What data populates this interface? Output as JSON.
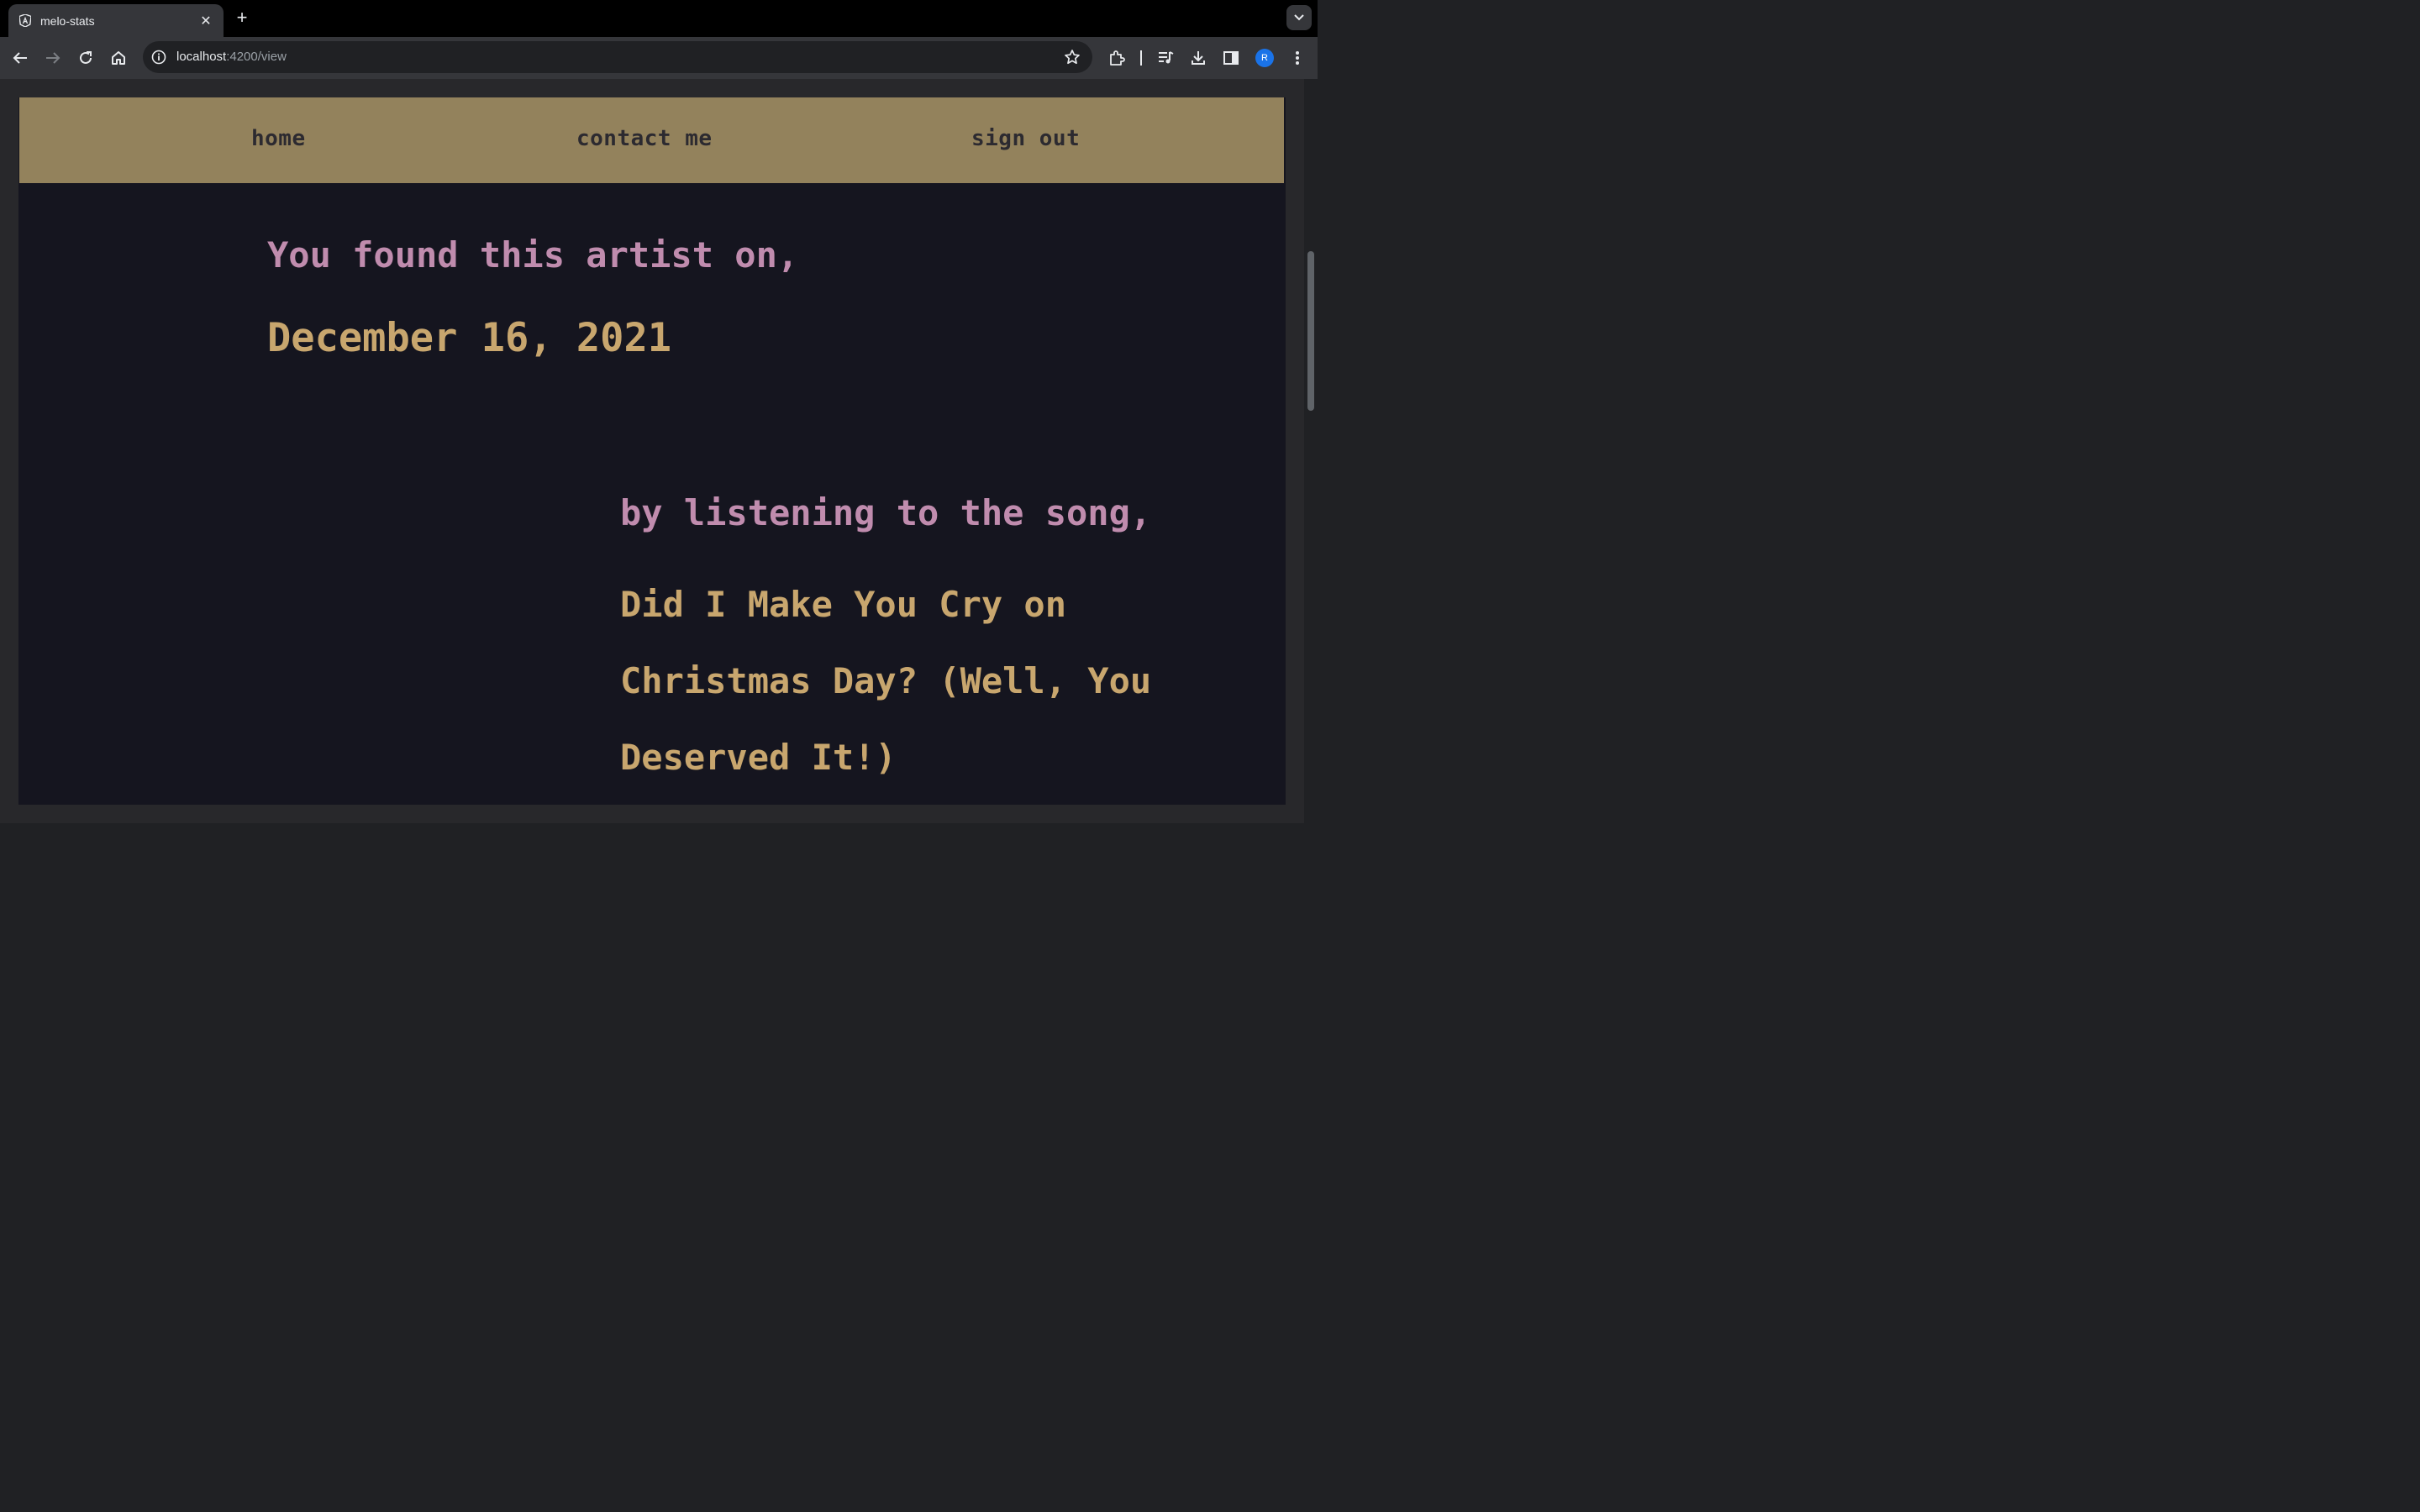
{
  "browser": {
    "tab": {
      "title": "melo-stats",
      "favicon": "angular-icon"
    },
    "url": {
      "host": "localhost",
      "path": ":4200/view"
    },
    "profile_initial": "R"
  },
  "nav": {
    "home": "home",
    "contact": "contact me",
    "signout": "sign out"
  },
  "discovery": {
    "found_label": "You found this artist on,",
    "date": "December 16, 2021",
    "song_label": "by listening to the song,",
    "song_title": "Did I Make You Cry on Christmas Day? (Well, You Deserved It!)"
  },
  "colors": {
    "navbar": "#93825c",
    "page_background": "#15151f",
    "label_pink": "#c08cae",
    "accent_gold": "#c8a66e"
  }
}
